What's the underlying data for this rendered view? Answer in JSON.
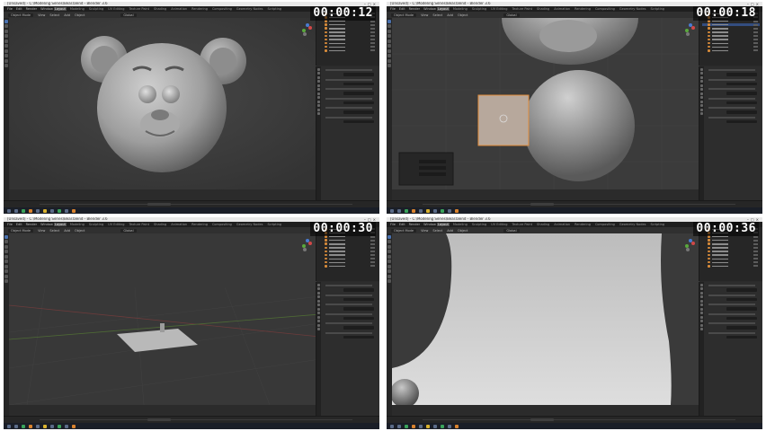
{
  "panels": [
    {
      "id": "p1",
      "window_title": "[Unsaved] - C:\\Modeling Series\\Bear.blend - Blender 3.6",
      "timestamp": "00:00:12",
      "menu": [
        "File",
        "Edit",
        "Render",
        "Window",
        "Help"
      ],
      "workspaces": [
        "Layout",
        "Modeling",
        "Sculpting",
        "UV Editing",
        "Texture Paint",
        "Shading",
        "Animation",
        "Rendering",
        "Compositing",
        "Geometry Nodes",
        "Scripting"
      ],
      "active_workspace": "Layout",
      "header": {
        "mode": "Object Mode",
        "view": "View",
        "select": "Select",
        "add": "Add",
        "object": "Object",
        "orientation": "Global"
      },
      "scene": "bear"
    },
    {
      "id": "p2",
      "window_title": "[Unsaved] - C:\\Modeling Series\\Bear.blend - Blender 3.6",
      "timestamp": "00:00:18",
      "menu": [
        "File",
        "Edit",
        "Render",
        "Window",
        "Help"
      ],
      "workspaces": [
        "Layout",
        "Modeling",
        "Sculpting",
        "UV Editing",
        "Texture Paint",
        "Shading",
        "Animation",
        "Rendering",
        "Compositing",
        "Geometry Nodes",
        "Scripting"
      ],
      "active_workspace": "Layout",
      "header": {
        "mode": "Object Mode",
        "view": "View",
        "select": "Select",
        "add": "Add",
        "object": "Object",
        "orientation": "Global"
      },
      "scene": "spheres"
    },
    {
      "id": "p3",
      "window_title": "[Unsaved] - C:\\Modeling Series\\Bear.blend - Blender 3.6",
      "timestamp": "00:00:30",
      "menu": [
        "File",
        "Edit",
        "Render",
        "Window",
        "Help"
      ],
      "workspaces": [
        "Layout",
        "Modeling",
        "Sculpting",
        "UV Editing",
        "Texture Paint",
        "Shading",
        "Animation",
        "Rendering",
        "Compositing",
        "Geometry Nodes",
        "Scripting"
      ],
      "active_workspace": "Layout",
      "header": {
        "mode": "Object Mode",
        "view": "View",
        "select": "Select",
        "add": "Add",
        "object": "Object",
        "orientation": "Global"
      },
      "scene": "plane"
    },
    {
      "id": "p4",
      "window_title": "[Unsaved] - C:\\Modeling Series\\Bear.blend - Blender 3.6",
      "timestamp": "00:00:36",
      "menu": [
        "File",
        "Edit",
        "Render",
        "Window",
        "Help"
      ],
      "workspaces": [
        "Layout",
        "Modeling",
        "Sculpting",
        "UV Editing",
        "Texture Paint",
        "Shading",
        "Animation",
        "Rendering",
        "Compositing",
        "Geometry Nodes",
        "Scripting"
      ],
      "active_workspace": "Layout",
      "header": {
        "mode": "Object Mode",
        "view": "View",
        "select": "Select",
        "add": "Add",
        "object": "Object",
        "orientation": "Global"
      },
      "scene": "backdrop"
    }
  ],
  "colors": {
    "accent": "#4a72b0",
    "object_icon": "#d68a3a",
    "viewport": "#3a3a3a"
  }
}
